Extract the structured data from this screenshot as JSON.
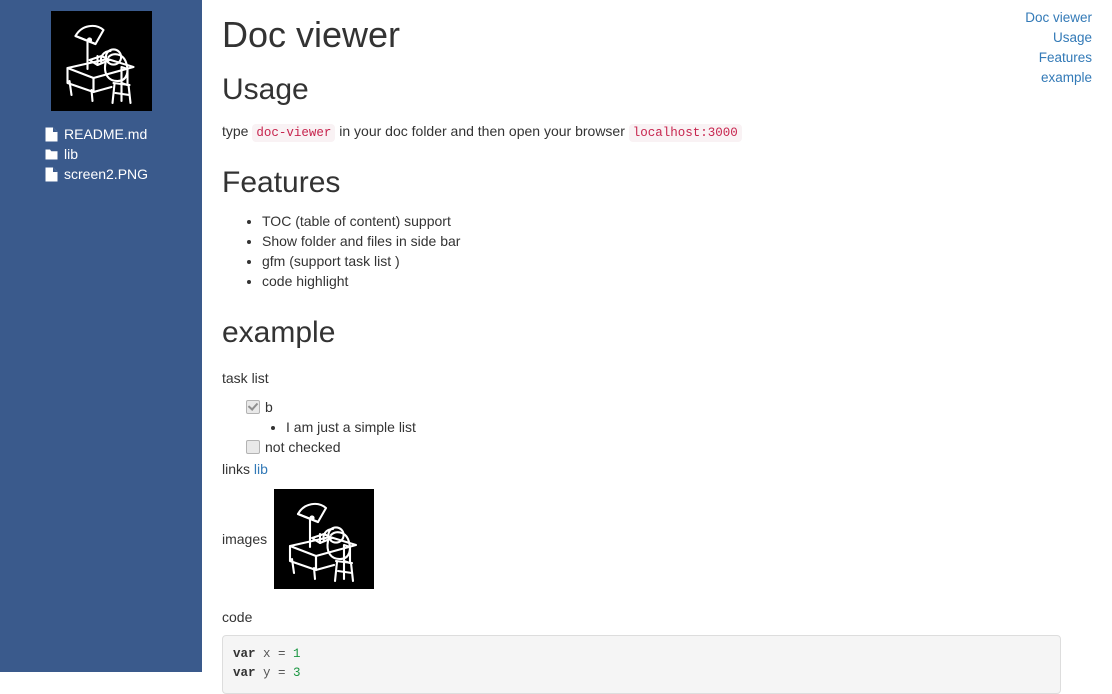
{
  "sidebar": {
    "logo_icon": "desk-lamp-person-illustration",
    "files": [
      {
        "name": "README.md",
        "icon": "file-icon"
      },
      {
        "name": "lib",
        "icon": "folder-icon"
      },
      {
        "name": "screen2.PNG",
        "icon": "file-icon"
      }
    ],
    "background_color": "#3a5a8c"
  },
  "toc": {
    "items": [
      {
        "label": "Doc viewer",
        "level": 1
      },
      {
        "label": "Usage",
        "level": 2
      },
      {
        "label": "Features",
        "level": 2
      },
      {
        "label": "example",
        "level": 2
      }
    ],
    "link_color": "#337ab7"
  },
  "main": {
    "title": "Doc viewer",
    "usage": {
      "heading": "Usage",
      "text_before_code": "type",
      "code1": "doc-viewer",
      "text_middle": "in your doc folder and then open your browser",
      "code2": "localhost:3000"
    },
    "features": {
      "heading": "Features",
      "items": [
        "TOC (table of content) support",
        "Show folder and files in side bar",
        "gfm (support task list )",
        "code highlight"
      ]
    },
    "example": {
      "heading": "example",
      "tasklist_label": "task list",
      "tasks": [
        {
          "label": "b",
          "checked": true
        },
        {
          "label": "not checked",
          "checked": false
        }
      ],
      "sub_item": "I am just a simple list",
      "links_label": "links",
      "links_link": "lib",
      "images_label": "images",
      "image_icon": "desk-lamp-person-illustration",
      "code_label": "code",
      "code_lines": [
        {
          "kw": "var",
          "rest": " x = ",
          "num": "1"
        },
        {
          "kw": "var",
          "rest": " y = ",
          "num": "3"
        }
      ]
    }
  },
  "colors": {
    "inline_code_text": "#c7254e",
    "inline_code_bg": "#f9f2f4",
    "code_keyword": "#333333",
    "code_number": "#1a9641",
    "codeblock_bg": "#f5f5f5",
    "codeblock_border": "#dddddd"
  }
}
